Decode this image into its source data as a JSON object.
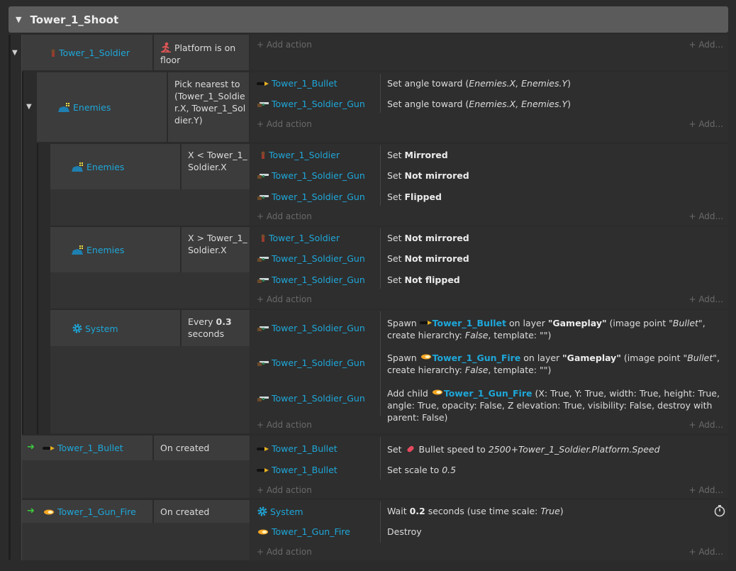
{
  "group": {
    "title": "Tower_1_Shoot"
  },
  "add_action": "Add action",
  "add_more": "Add...",
  "event1": {
    "object": "Tower_1_Soldier",
    "condition": "Platform is on floor"
  },
  "event2": {
    "object": "Enemies",
    "condition": "Pick nearest to (Tower_1_Soldier.X, Tower_1_Soldier.Y)",
    "actions": [
      {
        "object": "Tower_1_Bullet",
        "pre": "Set angle toward (",
        "italic": "Enemies.X, Enemies.Y",
        "post": ")"
      },
      {
        "object": "Tower_1_Soldier_Gun",
        "pre": "Set angle toward (",
        "italic": "Enemies.X, Enemies.Y",
        "post": ")"
      }
    ]
  },
  "event3": {
    "object": "Enemies",
    "condition": "X < Tower_1_Soldier.X",
    "actions": [
      {
        "object": "Tower_1_Soldier",
        "pre": "Set ",
        "bold": "Mirrored"
      },
      {
        "object": "Tower_1_Soldier_Gun",
        "pre": "Set ",
        "bold": "Not mirrored"
      },
      {
        "object": "Tower_1_Soldier_Gun",
        "pre": "Set ",
        "bold": "Flipped"
      }
    ]
  },
  "event4": {
    "object": "Enemies",
    "condition": "X > Tower_1_Soldier.X",
    "actions": [
      {
        "object": "Tower_1_Soldier",
        "pre": "Set ",
        "bold": "Not mirrored"
      },
      {
        "object": "Tower_1_Soldier_Gun",
        "pre": "Set ",
        "bold": "Not mirrored"
      },
      {
        "object": "Tower_1_Soldier_Gun",
        "pre": "Set ",
        "bold": "Not flipped"
      }
    ]
  },
  "event5": {
    "object": "System",
    "condition_pre": "Every ",
    "condition_bold": "0.3",
    "condition_post": "seconds",
    "actions": [
      {
        "object": "Tower_1_Soldier_Gun",
        "t1": "Spawn",
        "obj": "Tower_1_Bullet",
        "t2": "on layer",
        "layer": "\"Gameplay\"",
        "t3": "(image point",
        "ip": "\"Bullet\"",
        "t4": ", create hierarchy:",
        "h": "False",
        "t5": ", template: \"\")"
      },
      {
        "object": "Tower_1_Soldier_Gun",
        "t1": "Spawn",
        "obj": "Tower_1_Gun_Fire",
        "t2": "on layer",
        "layer": "\"Gameplay\"",
        "t3": "(image point",
        "ip": "\"Bullet\"",
        "t4": ", create hierarchy:",
        "h": "False",
        "t5": ", template: \"\")"
      },
      {
        "object": "Tower_1_Soldier_Gun",
        "t1": "Add child",
        "obj": "Tower_1_Gun_Fire",
        "params": "(X: True, Y: True, width: True, height: True, angle: True, opacity: False, Z elevation: True, visibility: False, destroy with parent: False)"
      }
    ]
  },
  "event6": {
    "object": "Tower_1_Bullet",
    "condition": "On created",
    "actions": [
      {
        "object": "Tower_1_Bullet",
        "pre": "Set",
        "behavior": "Bullet speed to",
        "italic": "2500+Tower_1_Soldier.Platform.Speed"
      },
      {
        "object": "Tower_1_Bullet",
        "pre": "Set scale to ",
        "italic": "0.5"
      }
    ]
  },
  "event7": {
    "object": "Tower_1_Gun_Fire",
    "condition": "On created",
    "actions": [
      {
        "object": "System",
        "pre": "Wait ",
        "bold": "0.2",
        "mid": " seconds (use time scale: ",
        "italic": "True",
        "post": ")"
      },
      {
        "object": "Tower_1_Gun_Fire",
        "pre": "Destroy"
      }
    ]
  },
  "colors": {
    "object_link": "#1ea7d9",
    "header": "#5b5b5b",
    "cell": "#3c3c3c",
    "actions_bg": "#2e2e2e",
    "trigger_arrow": "#3cc73c"
  },
  "icons": [
    "soldier-icon",
    "bullet-icon",
    "gun-icon",
    "enemies-icon",
    "gear-icon",
    "gun-fire-icon",
    "platform-behavior-icon",
    "bullet-behavior-icon",
    "stopwatch-icon",
    "plus-icon",
    "trigger-arrow-icon",
    "collapse-triangle-icon"
  ]
}
